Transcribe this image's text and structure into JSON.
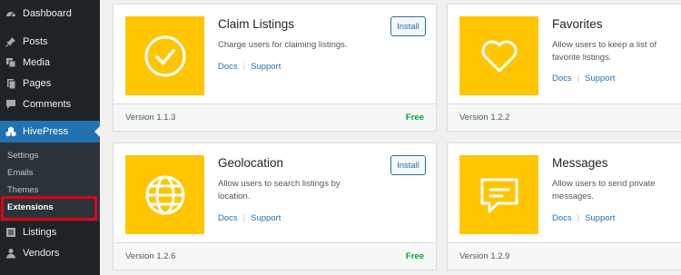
{
  "sidebar": {
    "items": [
      {
        "label": "Dashboard",
        "icon": "dashboard-icon"
      },
      {
        "label": "Posts",
        "icon": "pin-icon"
      },
      {
        "label": "Media",
        "icon": "media-icon"
      },
      {
        "label": "Pages",
        "icon": "pages-icon"
      },
      {
        "label": "Comments",
        "icon": "comments-icon"
      },
      {
        "label": "HivePress",
        "icon": "hivepress-icon"
      },
      {
        "label": "Listings",
        "icon": "listings-icon"
      },
      {
        "label": "Vendors",
        "icon": "vendors-icon"
      }
    ],
    "submenu": [
      "Settings",
      "Emails",
      "Themes",
      "Extensions"
    ],
    "active_color": "#2271b1",
    "highlight_color": "#e0001b"
  },
  "extensions": [
    {
      "title": "Claim Listings",
      "description": "Charge users for claiming listings.",
      "docs": "Docs",
      "support": "Support",
      "install": "Install",
      "version": "Version 1.1.3",
      "price": "Free",
      "icon": "checkmark-circle-icon"
    },
    {
      "title": "Favorites",
      "description": "Allow users to keep a list of favorite listings.",
      "docs": "Docs",
      "support": "Support",
      "install": "",
      "version": "Version 1.2.2",
      "price": "",
      "icon": "heart-icon"
    },
    {
      "title": "Geolocation",
      "description": "Allow users to search listings by location.",
      "docs": "Docs",
      "support": "Support",
      "install": "Install",
      "version": "Version 1.2.6",
      "price": "Free",
      "icon": "globe-icon"
    },
    {
      "title": "Messages",
      "description": "Allow users to send private messages.",
      "docs": "Docs",
      "support": "Support",
      "install": "",
      "version": "Version 1.2.9",
      "price": "",
      "icon": "message-bubble-icon"
    }
  ],
  "colors": {
    "thumb": "#ffc600",
    "link": "#2271b1",
    "free": "#00a32a"
  }
}
